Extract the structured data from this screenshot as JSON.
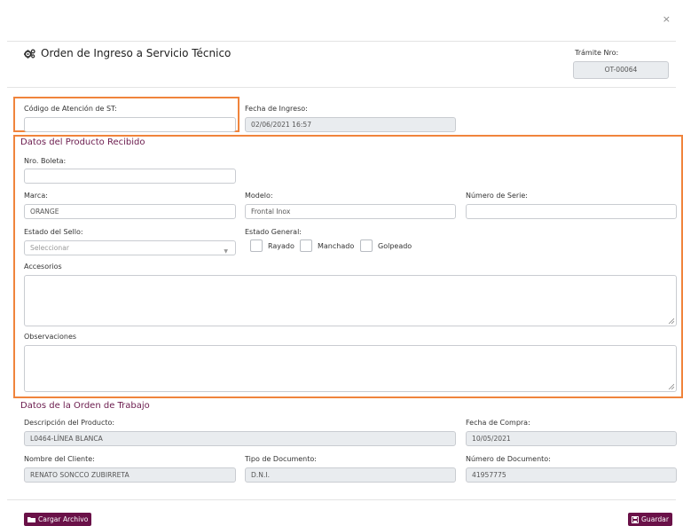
{
  "header": {
    "close_symbol": "×",
    "title": "Orden de Ingreso a Servicio Técnico",
    "title_icon": "gears-icon",
    "tramite_label": "Trámite Nro:",
    "tramite_value": "OT-00064"
  },
  "top_row": {
    "codigo_label": "Código de Atención de ST:",
    "codigo_value": "",
    "fecha_ingreso_label": "Fecha de Ingreso:",
    "fecha_ingreso_value": "02/06/2021 16:57"
  },
  "producto": {
    "section_title": "Datos del Producto Recibido",
    "boleta_label": "Nro. Boleta:",
    "boleta_value": "",
    "marca_label": "Marca:",
    "marca_value": "ORANGE",
    "modelo_label": "Modelo:",
    "modelo_value": "Frontal Inox",
    "serie_label": "Número de Serie:",
    "serie_value": "",
    "sello_label": "Estado del Sello:",
    "sello_placeholder": "Seleccionar",
    "estado_general_label": "Estado General:",
    "estado_options": [
      "Rayado",
      "Manchado",
      "Golpeado"
    ],
    "accesorios_label": "Accesorios",
    "observaciones_label": "Observaciones"
  },
  "orden": {
    "section_title": "Datos de la Orden de Trabajo",
    "descripcion_label": "Descripción del Producto:",
    "descripcion_value": "L0464-LÍNEA BLANCA",
    "fecha_compra_label": "Fecha de Compra:",
    "fecha_compra_value": "10/05/2021",
    "cliente_label": "Nombre del Cliente:",
    "cliente_value": "RENATO SONCCO ZUBIRRETA",
    "tipo_doc_label": "Tipo de Documento:",
    "tipo_doc_value": "D.N.I.",
    "num_doc_label": "Número de Documento:",
    "num_doc_value": "41957775"
  },
  "footer": {
    "cargar_label": "Cargar Archivo",
    "guardar_label": "Guardar"
  },
  "colors": {
    "accent": "#6a1148",
    "highlight": "#f0843c",
    "section": "#6b1b4d"
  }
}
